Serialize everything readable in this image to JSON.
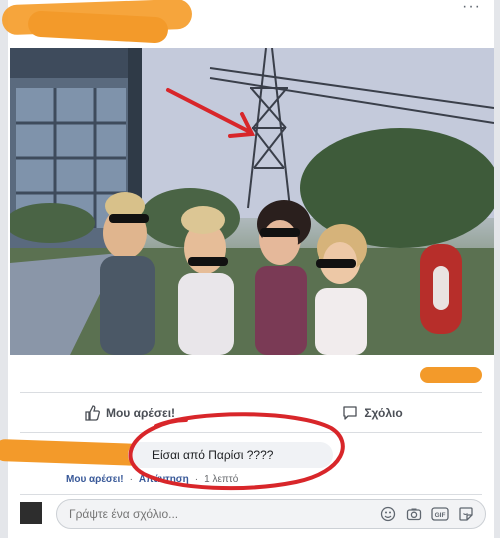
{
  "post": {
    "more_icon": "ellipsis-icon"
  },
  "actions": {
    "like_label": "Μου αρέσει!",
    "comment_label": "Σχόλιο"
  },
  "comment": {
    "text": "Είσαι από Παρίσι ????",
    "like_link": "Μου αρέσει!",
    "reply_link": "Απάντηση",
    "separator": "·",
    "time": "1 λεπτό"
  },
  "composer": {
    "placeholder": "Γράψτε ένα σχόλιο...",
    "icons": [
      "emoji-icon",
      "camera-icon",
      "gif-icon",
      "sticker-icon"
    ],
    "gif_label": "GIF"
  },
  "colors": {
    "redaction": "#f39a2a",
    "annotation_red": "#d8262a",
    "link": "#385898"
  }
}
